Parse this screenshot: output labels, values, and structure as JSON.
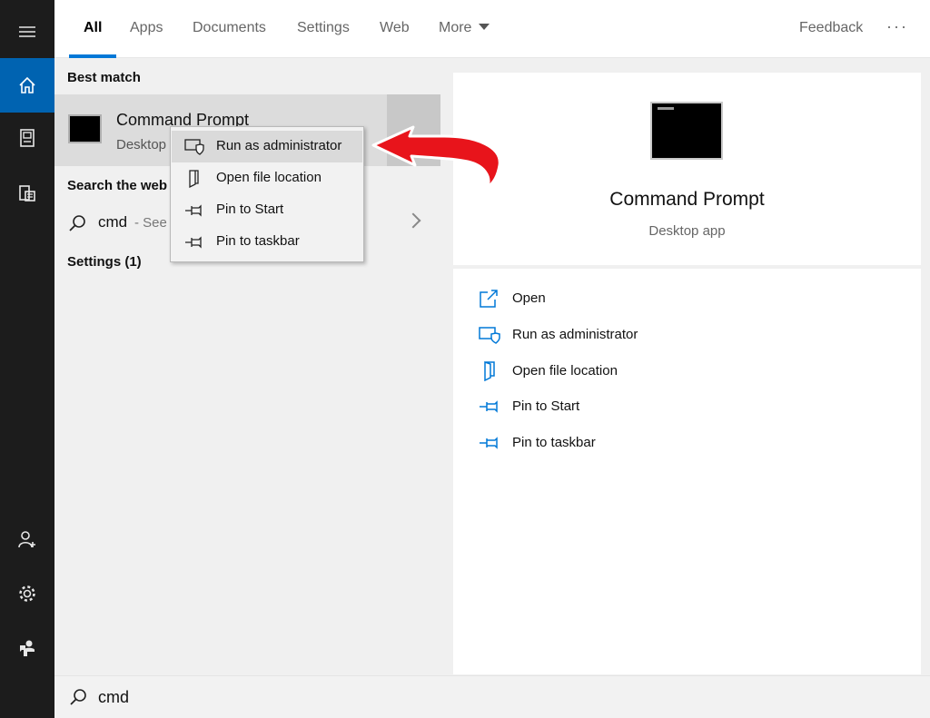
{
  "tabs": [
    {
      "label": "All"
    },
    {
      "label": "Apps"
    },
    {
      "label": "Documents"
    },
    {
      "label": "Settings"
    },
    {
      "label": "Web"
    },
    {
      "label": "More"
    }
  ],
  "feedback_label": "Feedback",
  "more_options": "···",
  "results": {
    "best_match_heading": "Best match",
    "best_match": {
      "title": "Command Prompt",
      "subtitle": "Desktop app"
    },
    "search_web_heading": "Search the web",
    "web_query": "cmd",
    "web_query_suffix": "- See web results",
    "settings_heading": "Settings (1)"
  },
  "context_menu": [
    {
      "label": "Run as administrator",
      "icon": "shield-icon"
    },
    {
      "label": "Open file location",
      "icon": "folder-icon"
    },
    {
      "label": "Pin to Start",
      "icon": "pin-icon"
    },
    {
      "label": "Pin to taskbar",
      "icon": "pin-icon"
    }
  ],
  "preview": {
    "title": "Command Prompt",
    "subtitle": "Desktop app",
    "actions": [
      {
        "label": "Open",
        "icon": "open-icon"
      },
      {
        "label": "Run as administrator",
        "icon": "shield-icon"
      },
      {
        "label": "Open file location",
        "icon": "folder-icon"
      },
      {
        "label": "Pin to Start",
        "icon": "pin-icon"
      },
      {
        "label": "Pin to taskbar",
        "icon": "pin-icon"
      }
    ]
  },
  "search": {
    "value": "cmd"
  },
  "colors": {
    "accent": "#0078d7",
    "rail": "#1c1c1c",
    "annotation": "#e8141b"
  }
}
